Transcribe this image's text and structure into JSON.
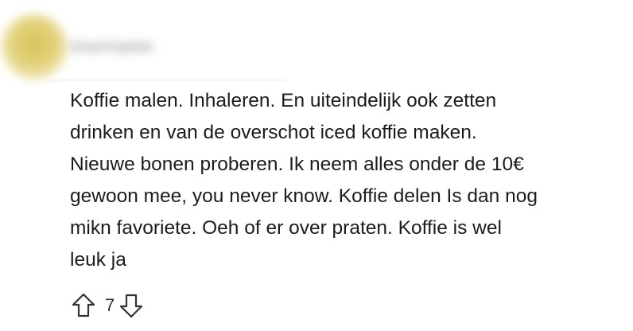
{
  "comment": {
    "author": "Username",
    "body_lines": [
      "Koffie malen. Inhaleren. En uiteindelijk ook zetten",
      "drinken en van de overschot iced koffie maken.",
      "Nieuwe bonen proberen. Ik neem alles onder de 10€",
      "gewoon mee, you never know. Koffie delen Is dan nog",
      "mikn favoriete. Oeh of er over praten. Koffie is wel",
      "leuk ja"
    ],
    "vote_count": "7",
    "upvote_icon": "arrow-up-outline-icon",
    "downvote_icon": "arrow-down-outline-icon"
  },
  "colors": {
    "avatar": "#d6c25a",
    "text": "#1c1c1c",
    "icon_stroke": "#333333"
  }
}
